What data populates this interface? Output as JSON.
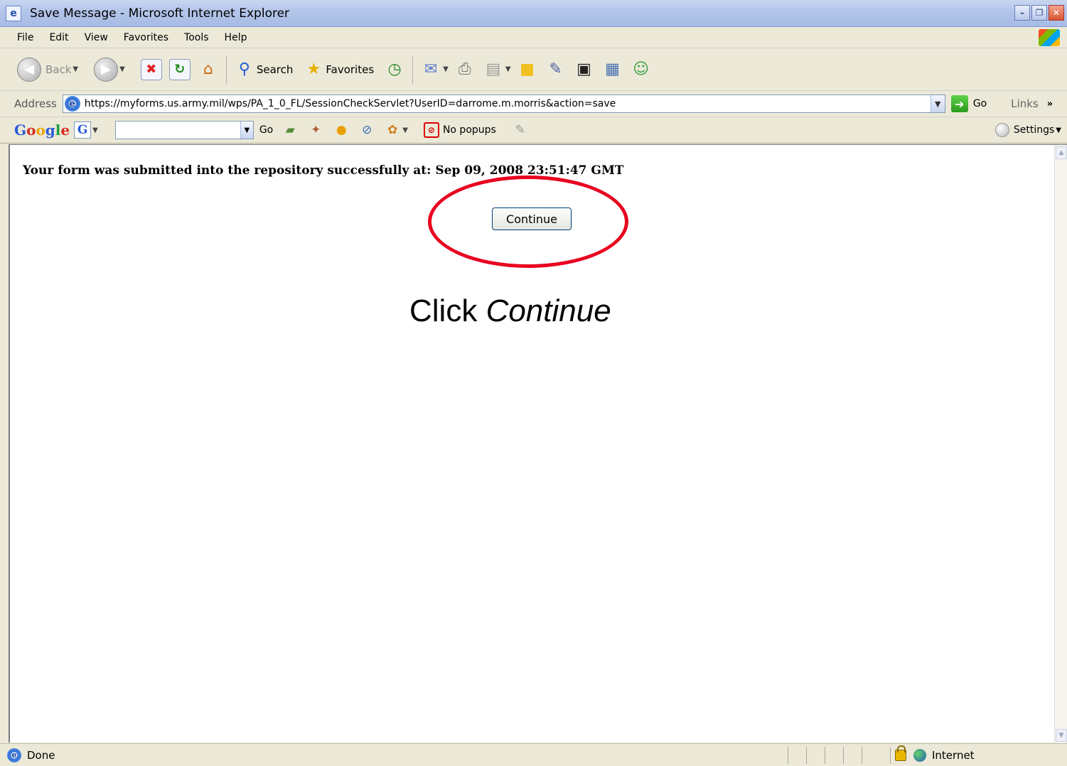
{
  "window": {
    "title": "Save Message - Microsoft Internet Explorer",
    "icon": "ie-icon",
    "controls": [
      "minimize",
      "maximize",
      "close"
    ]
  },
  "menu": {
    "items": [
      "File",
      "Edit",
      "View",
      "Favorites",
      "Tools",
      "Help"
    ]
  },
  "toolbar": {
    "back_label": "Back",
    "search_label": "Search",
    "favorites_label": "Favorites"
  },
  "address": {
    "label": "Address",
    "url": "https://myforms.us.army.mil/wps/PA_1_0_FL/SessionCheckServlet?UserID=darrome.m.morris&action=save",
    "go_label": "Go",
    "links_label": "Links",
    "more_glyph": "»"
  },
  "google": {
    "logo_parts": [
      "G",
      "o",
      "o",
      "g",
      "l",
      "e"
    ],
    "g_icon": "G",
    "search_value": "",
    "go_label": "Go",
    "nopopups_label": "No popups",
    "settings_label": "Settings"
  },
  "page": {
    "message": "Your form was submitted into the repository successfully at: Sep 09, 2008 23:51:47 GMT",
    "continue_label": "Continue",
    "instruction_prefix": "Click ",
    "instruction_emphasis": "Continue"
  },
  "status": {
    "text": "Done",
    "zone": "Internet"
  },
  "colors": {
    "annotation_ellipse": "#e8001f",
    "chrome": "#ece9d8"
  }
}
